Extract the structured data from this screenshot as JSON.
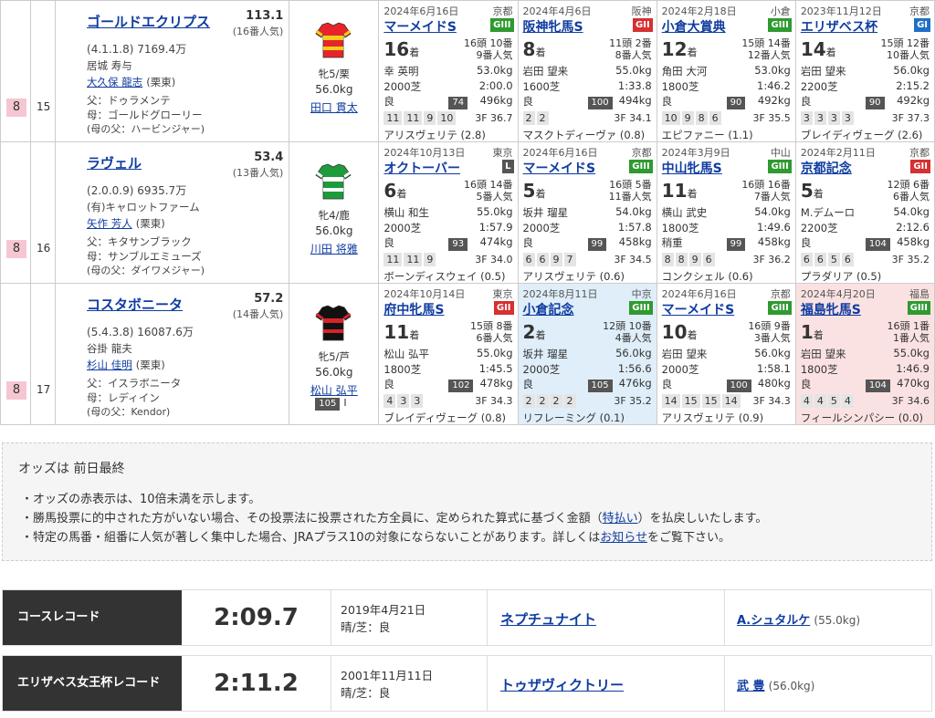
{
  "horses": [
    {
      "waku": "8",
      "num": "15",
      "name": "ゴールドエクリプス",
      "odds": "113.1",
      "popularity": "(16番人気)",
      "record": "(4.1.1.8) 7169.4万",
      "owner": "居城 寿与",
      "trainer": "大久保 龍志",
      "trainer_region": "(栗東)",
      "sire": "父：ドゥラメンテ",
      "dam": "母：ゴールドグローリー",
      "damsire": "(母の父：ハービンジャー)",
      "sex_age": "牝5/栗",
      "weight": "56.0kg",
      "jockey": "田口 貫太",
      "silk_colors": [
        "#e8242a",
        "#f4d019"
      ],
      "races": [
        {
          "date": "2024年6月16日",
          "venue": "京都",
          "name": "マーメイドS",
          "grade": "GIII",
          "grade_class": "G3",
          "rank": "16",
          "rank_unit": "着",
          "heads": "16頭 10番",
          "pop": "9番人気",
          "jockey": "幸 英明",
          "wt": "53.0kg",
          "dist": "2000芝",
          "time": "2:00.0",
          "cond": "良",
          "rate": "74",
          "bw": "496kg",
          "corners": [
            "11",
            "11",
            "9",
            "10"
          ],
          "l3f": "3F 36.7",
          "winner": "アリスヴェリテ (2.8)",
          "bg": ""
        },
        {
          "date": "2024年4月6日",
          "venue": "阪神",
          "name": "阪神牝馬S",
          "grade": "GII",
          "grade_class": "G2",
          "rank": "8",
          "rank_unit": "着",
          "heads": "11頭 2番",
          "pop": "8番人気",
          "jockey": "岩田 望来",
          "wt": "55.0kg",
          "dist": "1600芝",
          "time": "1:33.8",
          "cond": "良",
          "rate": "100",
          "bw": "494kg",
          "corners": [
            "2",
            "2"
          ],
          "l3f": "3F 34.1",
          "winner": "マスクトディーヴァ (0.8)",
          "bg": ""
        },
        {
          "date": "2024年2月18日",
          "venue": "小倉",
          "name": "小倉大賞典",
          "grade": "GIII",
          "grade_class": "G3",
          "rank": "12",
          "rank_unit": "着",
          "heads": "15頭 14番",
          "pop": "12番人気",
          "jockey": "角田 大河",
          "wt": "53.0kg",
          "dist": "1800芝",
          "time": "1:46.2",
          "cond": "良",
          "rate": "90",
          "bw": "492kg",
          "corners": [
            "10",
            "9",
            "8",
            "6"
          ],
          "l3f": "3F 35.5",
          "winner": "エピファニー (1.1)",
          "bg": ""
        },
        {
          "date": "2023年11月12日",
          "venue": "京都",
          "name": "エリザベス杯",
          "grade": "GI",
          "grade_class": "G1",
          "rank": "14",
          "rank_unit": "着",
          "heads": "15頭 12番",
          "pop": "10番人気",
          "jockey": "岩田 望来",
          "wt": "56.0kg",
          "dist": "2200芝",
          "time": "2:15.2",
          "cond": "良",
          "rate": "90",
          "bw": "492kg",
          "corners": [
            "3",
            "3",
            "3",
            "3"
          ],
          "l3f": "3F 37.3",
          "winner": "ブレイディヴェーグ (2.6)",
          "bg": ""
        }
      ]
    },
    {
      "waku": "8",
      "num": "16",
      "name": "ラヴェル",
      "odds": "53.4",
      "popularity": "(13番人気)",
      "record": "(2.0.0.9) 6935.7万",
      "owner": "(有)キャロットファーム",
      "trainer": "矢作 芳人",
      "trainer_region": "(栗東)",
      "sire": "父：キタサンブラック",
      "dam": "母：サンブルエミューズ",
      "damsire": "(母の父：ダイワメジャー)",
      "sex_age": "牝4/鹿",
      "weight": "56.0kg",
      "jockey": "川田 将雅",
      "silk_colors": [
        "#1e9b3a",
        "#ffffff"
      ],
      "races": [
        {
          "date": "2024年10月13日",
          "venue": "東京",
          "name": "オクトーバー",
          "grade": "L",
          "grade_class": "L",
          "rank": "6",
          "rank_unit": "着",
          "heads": "16頭 14番",
          "pop": "5番人気",
          "jockey": "横山 和生",
          "wt": "55.0kg",
          "dist": "2000芝",
          "time": "1:57.9",
          "cond": "良",
          "rate": "93",
          "bw": "474kg",
          "corners": [
            "11",
            "11",
            "9"
          ],
          "l3f": "3F 34.0",
          "winner": "ボーンディスウェイ (0.5)",
          "bg": ""
        },
        {
          "date": "2024年6月16日",
          "venue": "京都",
          "name": "マーメイドS",
          "grade": "GIII",
          "grade_class": "G3",
          "rank": "5",
          "rank_unit": "着",
          "heads": "16頭 5番",
          "pop": "11番人気",
          "jockey": "坂井 瑠星",
          "wt": "54.0kg",
          "dist": "2000芝",
          "time": "1:57.8",
          "cond": "良",
          "rate": "99",
          "bw": "458kg",
          "corners": [
            "6",
            "6",
            "9",
            "7"
          ],
          "l3f": "3F 34.5",
          "winner": "アリスヴェリテ (0.6)",
          "bg": ""
        },
        {
          "date": "2024年3月9日",
          "venue": "中山",
          "name": "中山牝馬S",
          "grade": "GIII",
          "grade_class": "G3",
          "rank": "11",
          "rank_unit": "着",
          "heads": "16頭 16番",
          "pop": "7番人気",
          "jockey": "横山 武史",
          "wt": "54.0kg",
          "dist": "1800芝",
          "time": "1:49.6",
          "cond": "稍重",
          "rate": "99",
          "bw": "458kg",
          "corners": [
            "8",
            "8",
            "9",
            "6"
          ],
          "l3f": "3F 36.2",
          "winner": "コンクシェル (0.6)",
          "bg": ""
        },
        {
          "date": "2024年2月11日",
          "venue": "京都",
          "name": "京都記念",
          "grade": "GII",
          "grade_class": "G2",
          "rank": "5",
          "rank_unit": "着",
          "heads": "12頭 6番",
          "pop": "6番人気",
          "jockey": "M.デムーロ",
          "wt": "54.0kg",
          "dist": "2200芝",
          "time": "2:12.6",
          "cond": "良",
          "rate": "104",
          "bw": "458kg",
          "corners": [
            "6",
            "6",
            "5",
            "6"
          ],
          "l3f": "3F 35.2",
          "winner": "プラダリア (0.5)",
          "bg": ""
        }
      ]
    },
    {
      "waku": "8",
      "num": "17",
      "name": "コスタボニータ",
      "odds": "57.2",
      "popularity": "(14番人気)",
      "record": "(5.4.3.8) 16087.6万",
      "owner": "谷掛 龍夫",
      "trainer": "杉山 佳明",
      "trainer_region": "(栗東)",
      "sire": "父：イスラボニータ",
      "dam": "母：レディイン",
      "damsire": "(母の父：Kendor)",
      "sex_age": "牝5/芦",
      "weight": "56.0kg",
      "jockey": "松山 弘平",
      "jockey_rate": "105",
      "jockey_rate_suffix": "I",
      "silk_colors": [
        "#111111",
        "#d8232a"
      ],
      "races": [
        {
          "date": "2024年10月14日",
          "venue": "東京",
          "name": "府中牝馬S",
          "grade": "GII",
          "grade_class": "G2",
          "rank": "11",
          "rank_unit": "着",
          "heads": "15頭 8番",
          "pop": "6番人気",
          "jockey": "松山 弘平",
          "wt": "55.0kg",
          "dist": "1800芝",
          "time": "1:45.5",
          "cond": "良",
          "rate": "102",
          "bw": "478kg",
          "corners": [
            "4",
            "3",
            "3"
          ],
          "l3f": "3F 34.3",
          "winner": "ブレイディヴェーグ (0.8)",
          "bg": ""
        },
        {
          "date": "2024年8月11日",
          "venue": "中京",
          "name": "小倉記念",
          "grade": "GIII",
          "grade_class": "G3",
          "rank": "2",
          "rank_unit": "着",
          "heads": "12頭 10番",
          "pop": "4番人気",
          "jockey": "坂井 瑠星",
          "wt": "56.0kg",
          "dist": "2000芝",
          "time": "1:56.6",
          "cond": "良",
          "rate": "105",
          "bw": "476kg",
          "corners": [
            "2",
            "2",
            "2",
            "2"
          ],
          "l3f": "3F 35.2",
          "winner": "リフレーミング (0.1)",
          "bg": "blue"
        },
        {
          "date": "2024年6月16日",
          "venue": "京都",
          "name": "マーメイドS",
          "grade": "GIII",
          "grade_class": "G3",
          "rank": "10",
          "rank_unit": "着",
          "heads": "16頭 9番",
          "pop": "3番人気",
          "jockey": "岩田 望来",
          "wt": "56.0kg",
          "dist": "2000芝",
          "time": "1:58.1",
          "cond": "良",
          "rate": "100",
          "bw": "480kg",
          "corners": [
            "14",
            "15",
            "15",
            "14"
          ],
          "l3f": "3F 34.3",
          "winner": "アリスヴェリテ (0.9)",
          "bg": ""
        },
        {
          "date": "2024年4月20日",
          "venue": "福島",
          "name": "福島牝馬S",
          "grade": "GIII",
          "grade_class": "G3",
          "rank": "1",
          "rank_unit": "着",
          "heads": "16頭 1番",
          "pop": "1番人気",
          "jockey": "岩田 望来",
          "wt": "55.0kg",
          "dist": "1800芝",
          "time": "1:46.9",
          "cond": "良",
          "rate": "104",
          "bw": "470kg",
          "corners": [
            "4",
            "4",
            "5",
            "4"
          ],
          "l3f": "3F 34.6",
          "winner": "フィールシンパシー (0.0)",
          "bg": "pink"
        }
      ]
    }
  ],
  "notes": {
    "title": "オッズは 前日最終",
    "line1": "・オッズの赤表示は、10倍未満を示します。",
    "line2_pre": "・勝馬投票に的中された方がいない場合、その投票法に投票された方全員に、定められた算式に基づく金額（",
    "line2_link": "特払い",
    "line2_post": "）を払戻しいたします。",
    "line3_pre": "・特定の馬番・組番に人気が著しく集中した場合、JRAプラス10の対象にならないことがあります。詳しくは",
    "line3_link": "お知らせ",
    "line3_post": "をご覧下さい。"
  },
  "records": [
    {
      "label": "コースレコード",
      "time": "2:09.7",
      "date": "2019年4月21日",
      "cond": "晴/芝：良",
      "horse": "ネプチュナイト",
      "jockey": "A.シュタルケ",
      "kg": "(55.0kg)"
    },
    {
      "label": "エリザベス女王杯レコード",
      "time": "2:11.2",
      "date": "2001年11月11日",
      "cond": "晴/芝：良",
      "horse": "トゥザヴィクトリー",
      "jockey": "武 豊",
      "kg": "(56.0kg)"
    }
  ]
}
